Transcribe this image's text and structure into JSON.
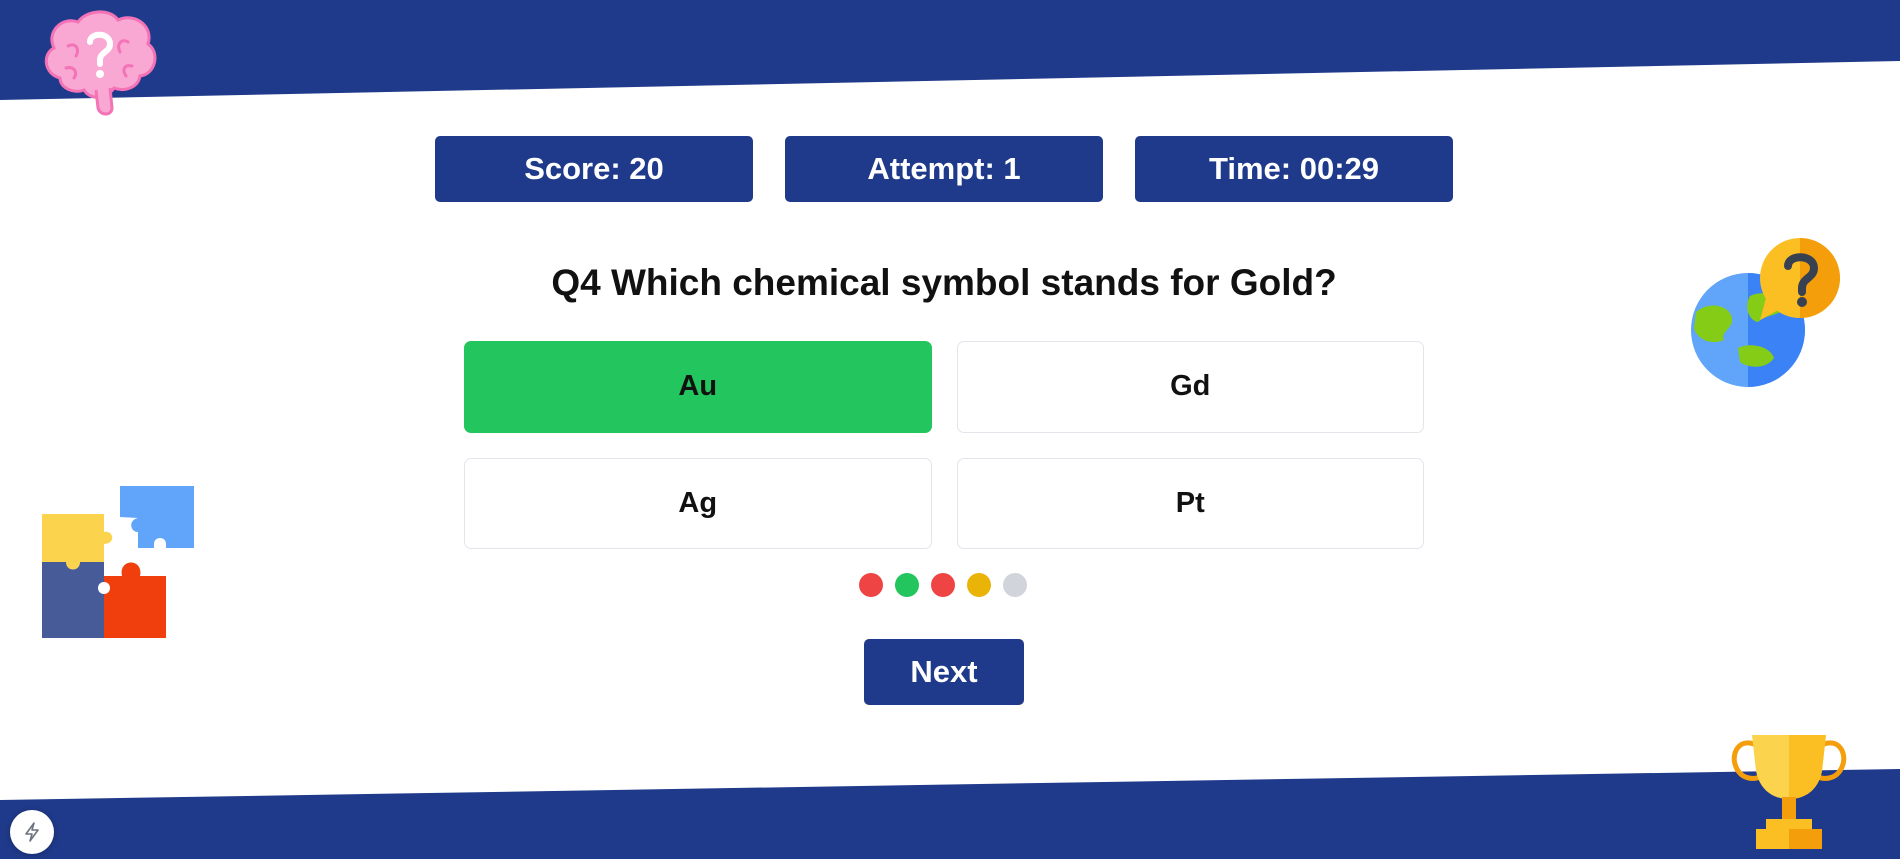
{
  "colors": {
    "brand_navy": "#1f3a8a",
    "correct_green": "#22c55e",
    "wrong_red": "#ef4444",
    "pending_yellow": "#eab308",
    "unanswered_gray": "#d1d5db"
  },
  "stats": {
    "score": "Score: 20",
    "attempt": "Attempt: 1",
    "time": "Time: 00:29"
  },
  "question": {
    "text": "Q4 Which chemical symbol stands for Gold?"
  },
  "options": [
    {
      "label": "Au",
      "state": "correct"
    },
    {
      "label": "Gd",
      "state": "default"
    },
    {
      "label": "Ag",
      "state": "default"
    },
    {
      "label": "Pt",
      "state": "default"
    }
  ],
  "progress": [
    "wrong",
    "correct",
    "wrong",
    "current",
    "unanswered"
  ],
  "buttons": {
    "next_label": "Next"
  },
  "icons": {
    "top_left": "brain-question-icon",
    "right": "globe-question-icon",
    "left": "puzzle-icon",
    "bottom_right": "trophy-icon",
    "corner": "lightning-icon"
  }
}
